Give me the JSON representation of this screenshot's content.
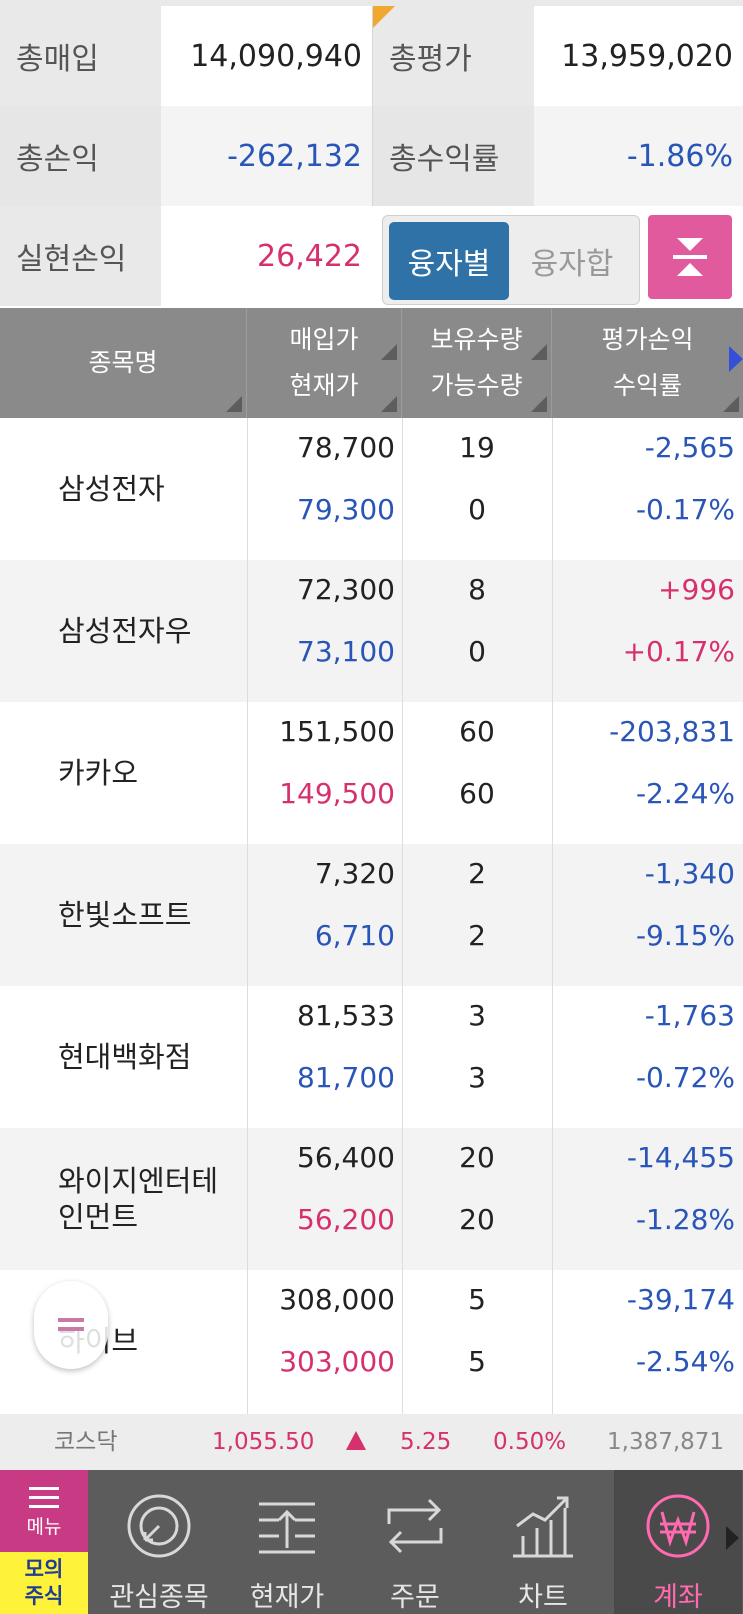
{
  "summary": {
    "total_purchase": {
      "label": "총매입",
      "value": "14,090,940"
    },
    "total_eval": {
      "label": "총평가",
      "value": "13,959,020"
    },
    "total_pl": {
      "label": "총손익",
      "value": "-262,132"
    },
    "total_return": {
      "label": "총수익률",
      "value": "-1.86%"
    },
    "realized_pl": {
      "label": "실현손익",
      "value": "26,422"
    },
    "toggle": {
      "active": "융자별",
      "inactive": "융자합"
    }
  },
  "table": {
    "headers": {
      "name": "종목명",
      "price_top": "매입가",
      "price_bottom": "현재가",
      "qty_top": "보유수량",
      "qty_bottom": "가능수량",
      "pl_top": "평가손익",
      "pl_bottom": "수익률"
    },
    "rows": [
      {
        "name": "삼성전자",
        "buy_price": "78,700",
        "cur_price": "79,300",
        "hold_qty": "19",
        "avail_qty": "0",
        "pl": "-2,565",
        "rate": "-0.17%"
      },
      {
        "name": "삼성전자우",
        "buy_price": "72,300",
        "cur_price": "73,100",
        "hold_qty": "8",
        "avail_qty": "0",
        "pl": "+996",
        "rate": "+0.17%"
      },
      {
        "name": "카카오",
        "buy_price": "151,500",
        "cur_price": "149,500",
        "hold_qty": "60",
        "avail_qty": "60",
        "pl": "-203,831",
        "rate": "-2.24%"
      },
      {
        "name": "한빛소프트",
        "buy_price": "7,320",
        "cur_price": "6,710",
        "hold_qty": "2",
        "avail_qty": "2",
        "pl": "-1,340",
        "rate": "-9.15%"
      },
      {
        "name": "현대백화점",
        "buy_price": "81,533",
        "cur_price": "81,700",
        "hold_qty": "3",
        "avail_qty": "3",
        "pl": "-1,763",
        "rate": "-0.72%"
      },
      {
        "name": "와이지엔터테인먼트",
        "name_line1": "와이지엔터테",
        "name_line2": "인먼트",
        "buy_price": "56,400",
        "cur_price": "56,200",
        "hold_qty": "20",
        "avail_qty": "20",
        "pl": "-14,455",
        "rate": "-1.28%"
      },
      {
        "name": "하이브",
        "buy_price": "308,000",
        "cur_price": "303,000",
        "hold_qty": "5",
        "avail_qty": "5",
        "pl": "-39,174",
        "rate": "-2.54%"
      }
    ]
  },
  "ticker": {
    "name": "코스닥",
    "value": "1,055.50",
    "direction": "up",
    "change": "5.25",
    "percent": "0.50%",
    "volume": "1,387,871"
  },
  "bottom_nav": {
    "menu_label": "메뉴",
    "mode_line1": "모의",
    "mode_line2": "주식",
    "items": [
      {
        "label": "관심종목",
        "icon": "watchlist-icon"
      },
      {
        "label": "현재가",
        "icon": "current-price-icon"
      },
      {
        "label": "주문",
        "icon": "order-icon"
      },
      {
        "label": "차트",
        "icon": "chart-icon"
      },
      {
        "label": "계좌",
        "icon": "won-account-icon",
        "active": true
      }
    ]
  },
  "colors": {
    "negative": "#2a55b8",
    "positive": "#d6316e",
    "toggle_active": "#2f72a8",
    "accent_pink": "#e25a9e",
    "nav_active": "#ff6ab0",
    "mode_badge": "#fff23a"
  }
}
